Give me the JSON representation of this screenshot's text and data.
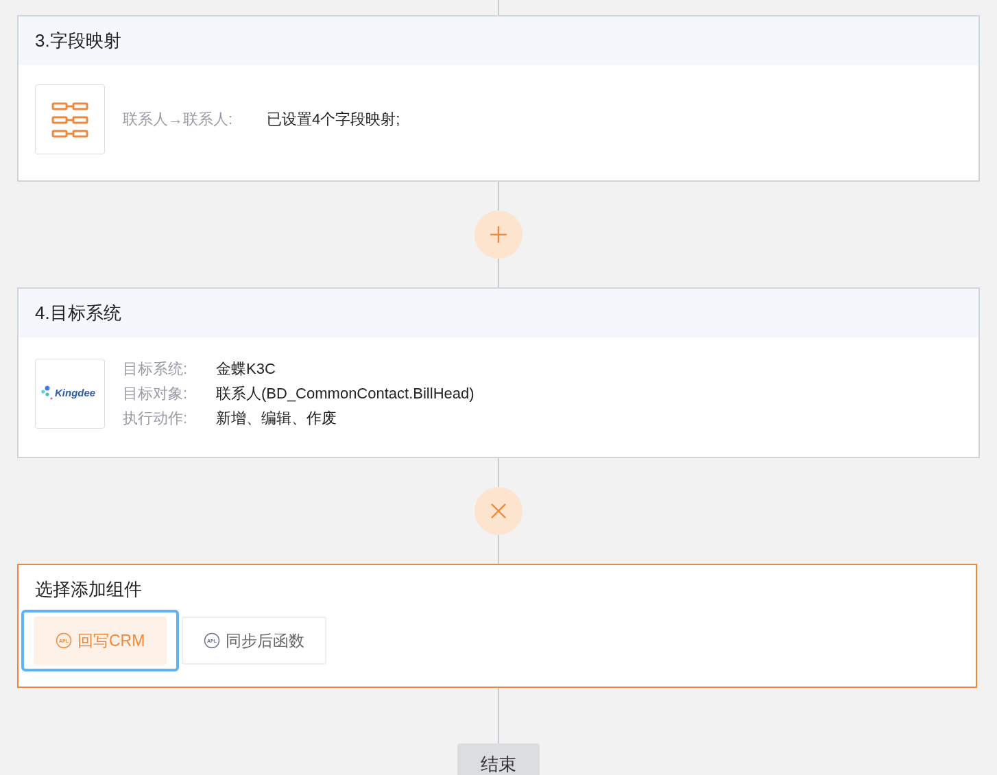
{
  "steps": [
    {
      "kind": "mapping",
      "title": "3.字段映射",
      "rows": [
        {
          "label": "联系人→联系人:",
          "value": "已设置4个字段映射;"
        }
      ]
    },
    {
      "kind": "add"
    },
    {
      "kind": "system",
      "title": "4.目标系统",
      "logo_text": "Kingdee",
      "rows": [
        {
          "label": "目标系统:",
          "value": "金蝶K3C"
        },
        {
          "label": "目标对象:",
          "value": "联系人(BD_CommonContact.BillHead)"
        },
        {
          "label": "执行动作:",
          "value": "新增、编辑、作废"
        }
      ]
    },
    {
      "kind": "remove"
    },
    {
      "kind": "picker",
      "title": "选择添加组件",
      "options": [
        {
          "label": "回写CRM",
          "icon_text": "APL",
          "selected": true
        },
        {
          "label": "同步后函数",
          "icon_text": "APL",
          "selected": false
        }
      ]
    }
  ],
  "end_label": "结束"
}
